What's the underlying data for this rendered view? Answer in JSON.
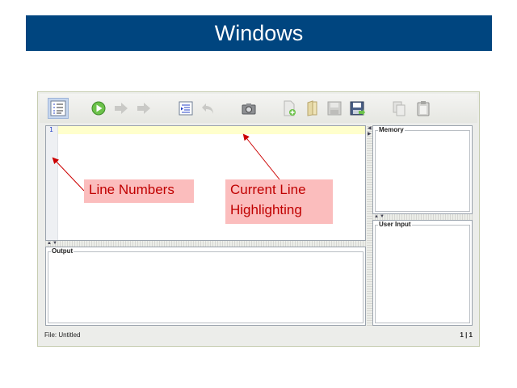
{
  "slide": {
    "title": "Windows"
  },
  "toolbar": {
    "buttons": [
      {
        "name": "line-numbers-toggle",
        "icon": "list-numbered-icon",
        "active": true
      },
      {
        "name": "run",
        "icon": "play-icon"
      },
      {
        "name": "step",
        "icon": "arrow-right-icon"
      },
      {
        "name": "step-over",
        "icon": "arrow-right-icon"
      },
      {
        "name": "format",
        "icon": "indent-icon"
      },
      {
        "name": "undo",
        "icon": "undo-icon"
      },
      {
        "name": "screenshot",
        "icon": "camera-icon"
      },
      {
        "name": "new-file",
        "icon": "new-file-icon"
      },
      {
        "name": "open-file",
        "icon": "open-file-icon"
      },
      {
        "name": "save",
        "icon": "save-icon"
      },
      {
        "name": "save-as",
        "icon": "save-as-icon"
      },
      {
        "name": "copy",
        "icon": "copy-icon"
      },
      {
        "name": "paste",
        "icon": "paste-icon"
      }
    ]
  },
  "editor": {
    "line_numbers": [
      "1"
    ]
  },
  "panels": {
    "output": {
      "label": "Output"
    },
    "memory": {
      "label": "Memory"
    },
    "user_input": {
      "label": "User Input"
    }
  },
  "statusbar": {
    "file": "File: Untitled",
    "position": "1 | 1"
  },
  "callouts": {
    "line_numbers": "Line Numbers",
    "current_line_1": "Current Line",
    "current_line_2": "Highlighting"
  },
  "colors": {
    "banner": "#00457f",
    "callout_bg": "#fbbdbd",
    "callout_text": "#c00000",
    "current_line": "#ffffcc"
  }
}
